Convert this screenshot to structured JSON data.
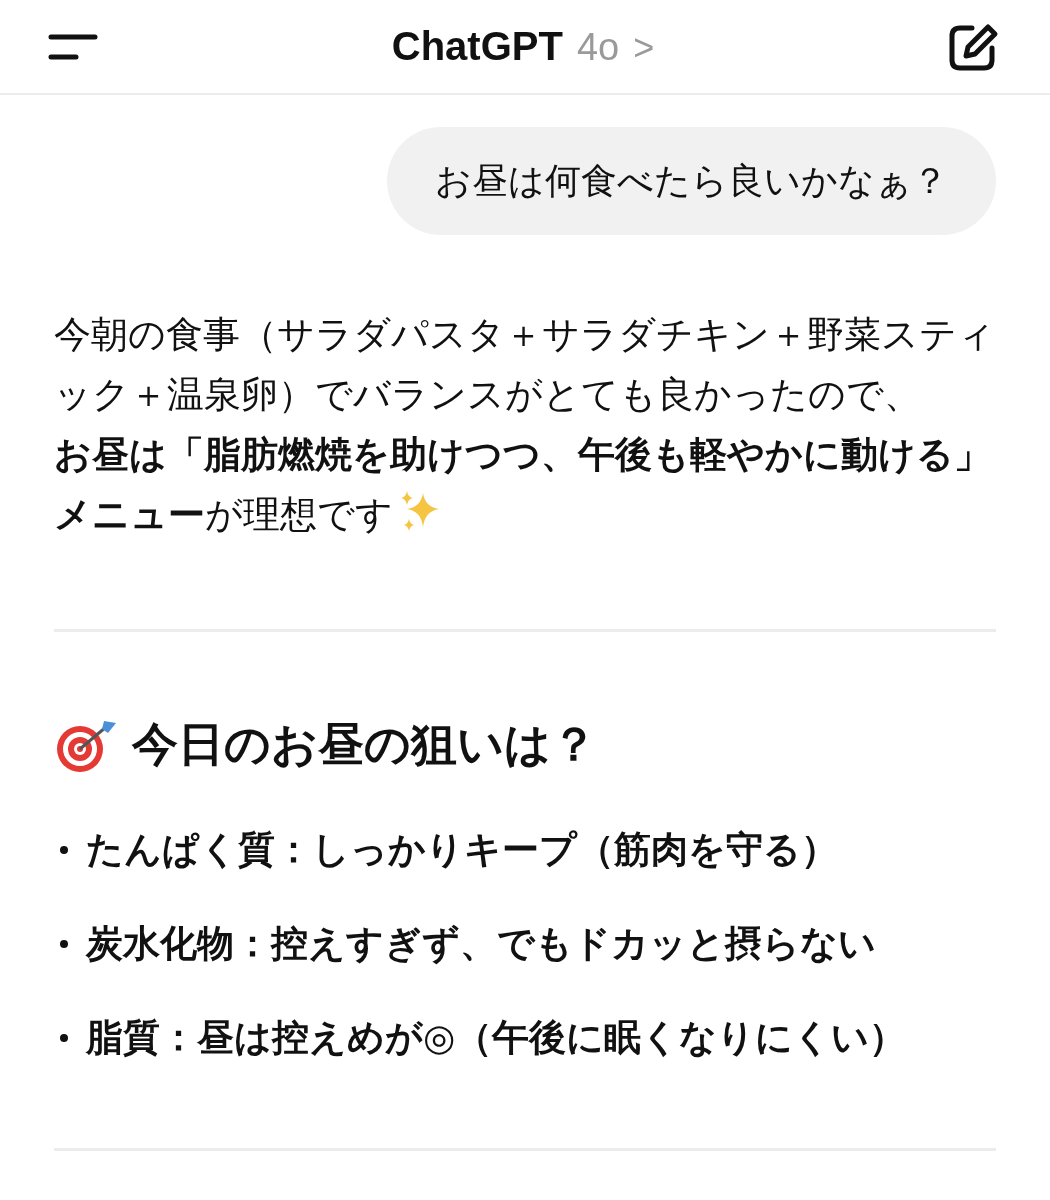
{
  "header": {
    "title": "ChatGPT",
    "model": "4o",
    "chevron": ">"
  },
  "user_message": "お昼は何食べたら良いかなぁ？",
  "assistant": {
    "paragraphs": [
      "今朝の食事（サラダパスタ＋サラダチキン＋野菜スティック＋温泉卵）でバランスがとても良かったので、",
      "**お昼は「脂肪燃焼を助けつつ、午後も軽やかに動ける」メニュー**が理想です"
    ],
    "heading": "今日のお昼の狙いは？",
    "bullets": [
      "たんぱく質：しっかりキープ（筋肉を守る）",
      "炭水化物：控えすぎず、でもドカッと摂らない",
      "脂質：昼は控えめが◎（午後に眠くなりにくい）"
    ]
  }
}
